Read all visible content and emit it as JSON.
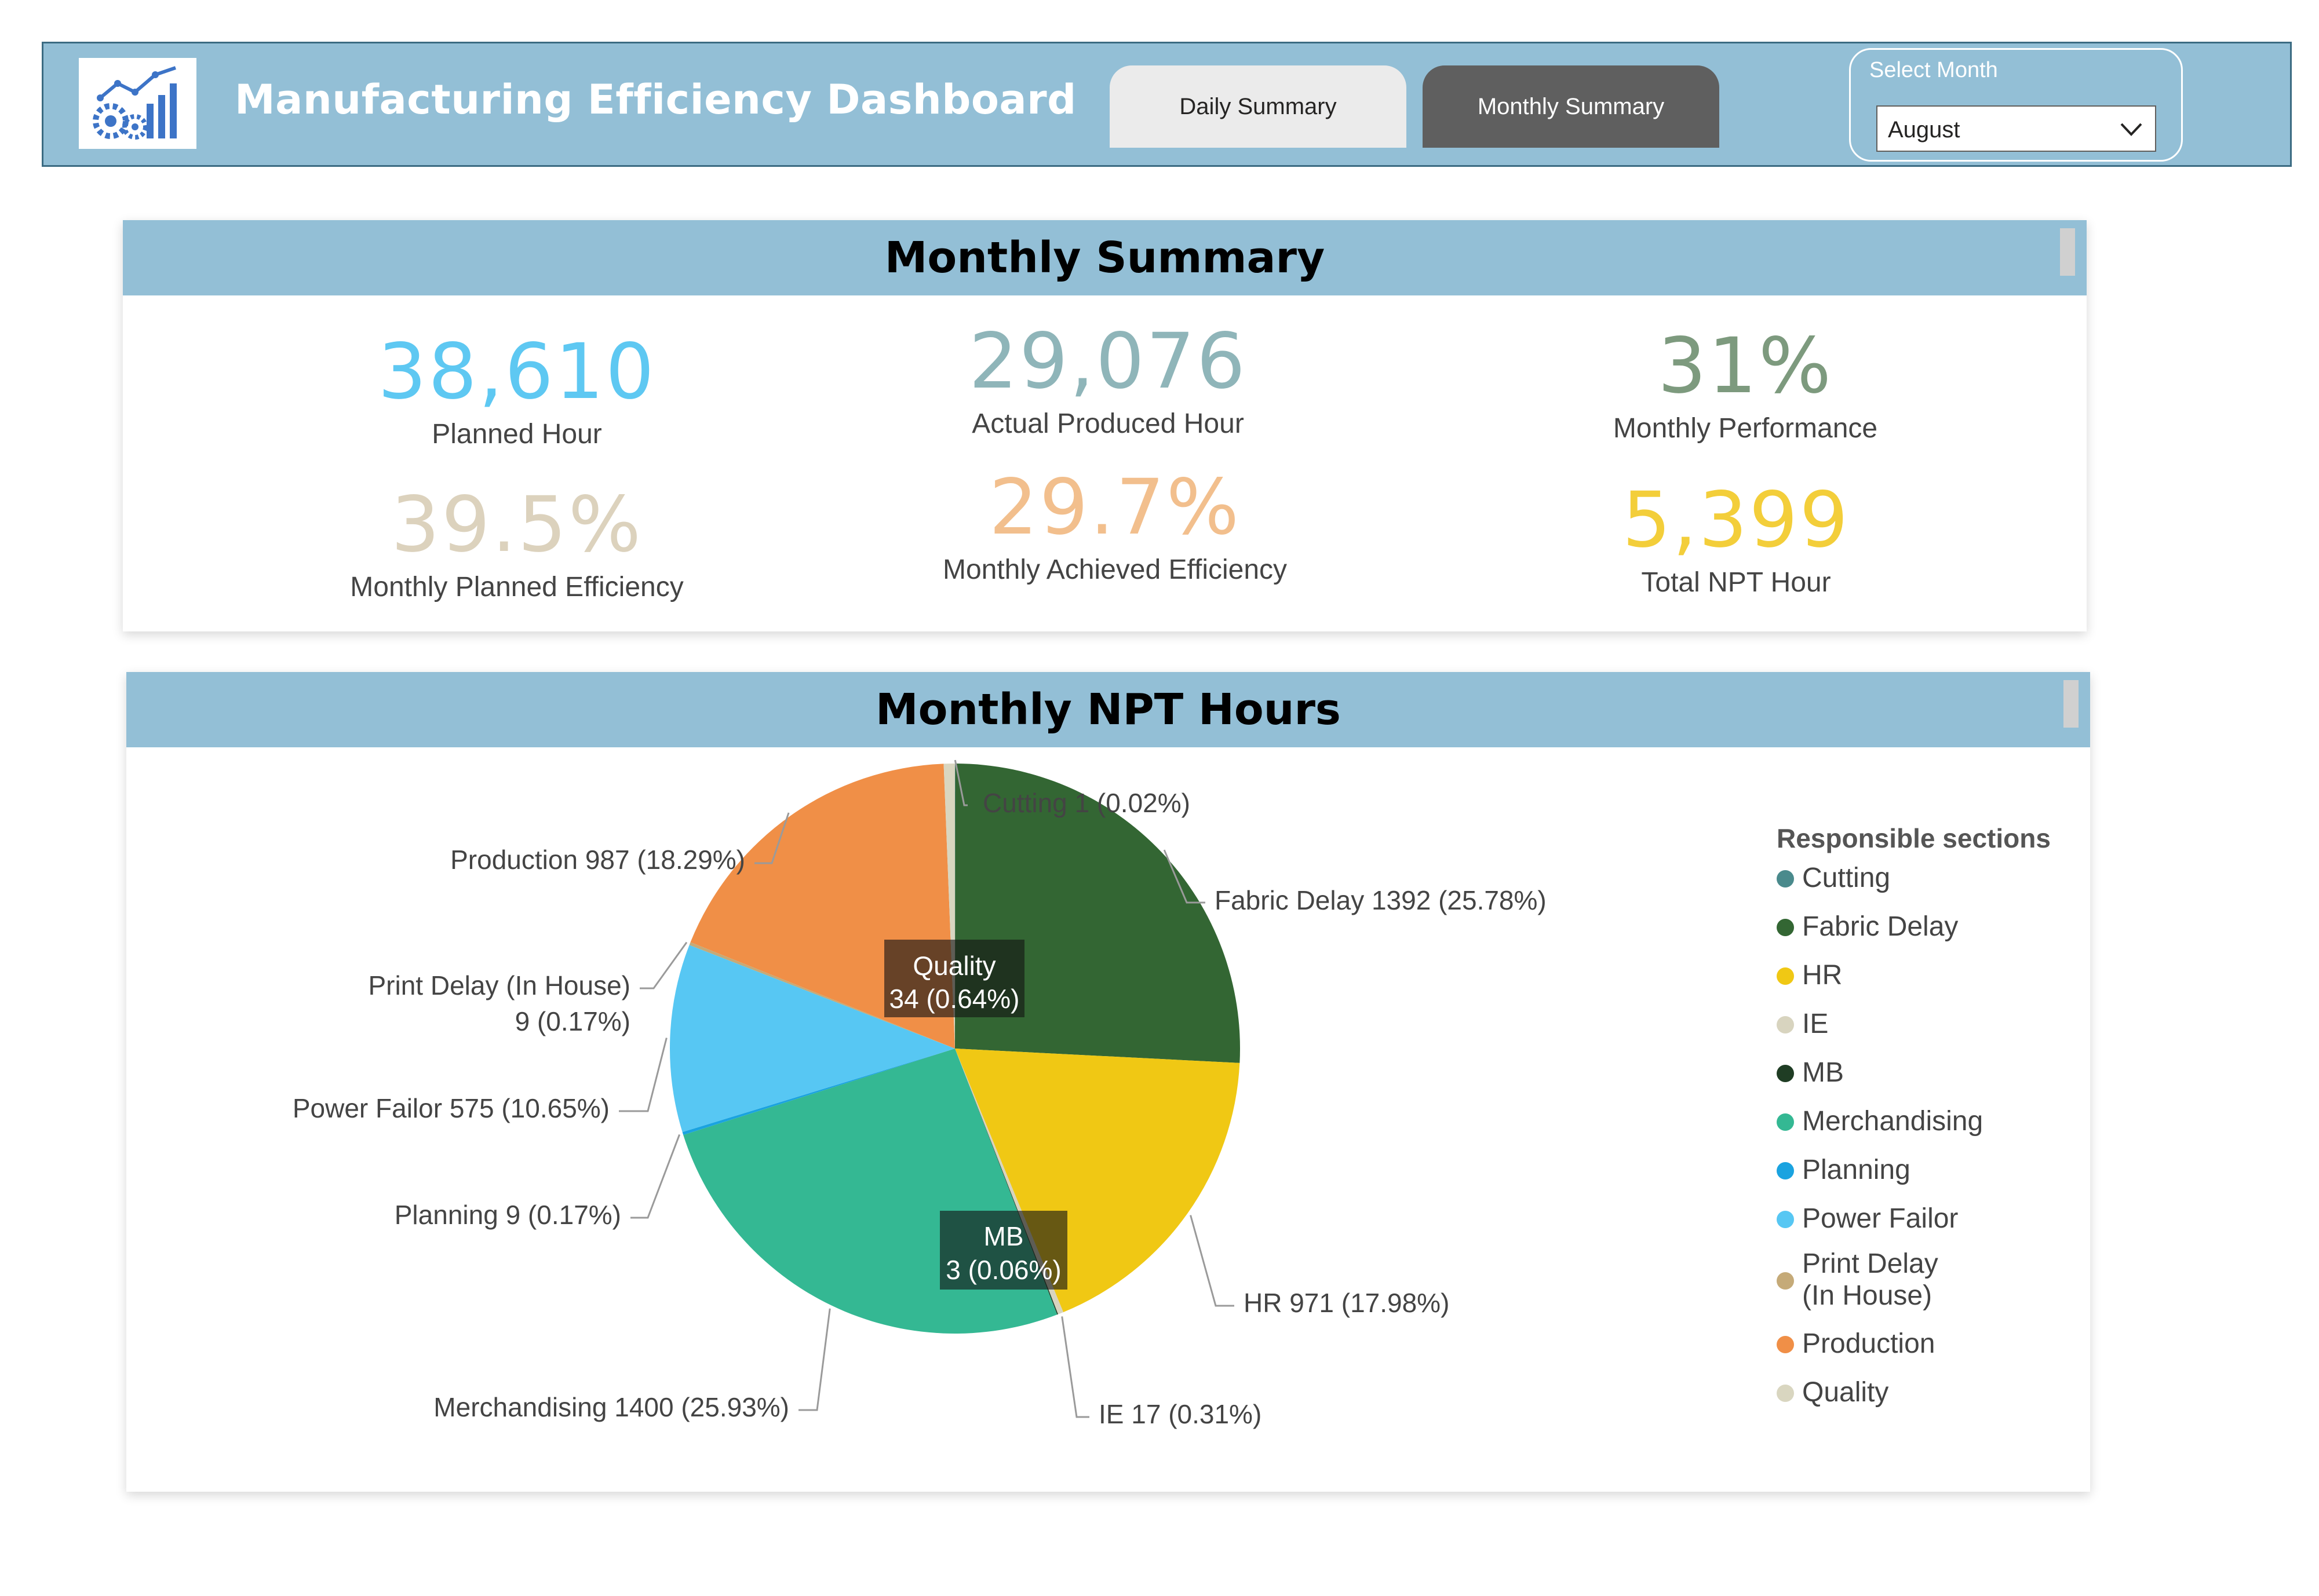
{
  "header": {
    "title": "Manufacturing Efficiency Dashboard",
    "logo_icon": "analytics-gears-icon",
    "tabs": [
      {
        "label": "Daily Summary",
        "active": false
      },
      {
        "label": "Monthly Summary",
        "active": true
      }
    ],
    "month_slicer": {
      "title": "Select Month",
      "selected": "August"
    }
  },
  "monthly_summary": {
    "title": "Monthly Summary",
    "kpis": [
      {
        "value": "38,610",
        "label": "Planned Hour",
        "color": "#5ec8f2"
      },
      {
        "value": "29,076",
        "label": "Actual Produced Hour",
        "color": "#8fb5b9"
      },
      {
        "value": "31%",
        "label": "Monthly Performance",
        "color": "#7d9a7e"
      },
      {
        "value": "39.5%",
        "label": "Monthly Planned Efficiency",
        "color": "#dcd2bd"
      },
      {
        "value": "29.7%",
        "label": "Monthly Achieved Efficiency",
        "color": "#f2bf8d"
      },
      {
        "value": "5,399",
        "label": "Total NPT Hour",
        "color": "#f3ce3a"
      }
    ]
  },
  "npt": {
    "title": "Monthly NPT Hours",
    "legend_title": "Responsible sections",
    "chart_data": {
      "type": "pie",
      "unit": "hours",
      "slices": [
        {
          "name": "Cutting",
          "legend": "Cutting",
          "value": 1,
          "percent": "0.02%",
          "label": "Cutting 1 (0.02%)",
          "color": "#4a8a8c"
        },
        {
          "name": "Fabric Delay",
          "legend": "Fabric Delay",
          "value": 1392,
          "percent": "25.78%",
          "label": "Fabric Delay 1392 (25.78%)",
          "color": "#336633"
        },
        {
          "name": "HR",
          "legend": "HR",
          "value": 971,
          "percent": "17.98%",
          "label": "HR 971 (17.98%)",
          "color": "#f0c814"
        },
        {
          "name": "IE",
          "legend": "IE",
          "value": 17,
          "percent": "0.31%",
          "label": "IE 17 (0.31%)",
          "color": "#d8d4bf"
        },
        {
          "name": "MB",
          "legend": "MB",
          "value": 3,
          "percent": "0.06%",
          "label_line1": "MB",
          "label_line2": "3 (0.06%)",
          "color": "#1f3d24"
        },
        {
          "name": "Merchandising",
          "legend": "Merchandising",
          "value": 1400,
          "percent": "25.93%",
          "label": "Merchandising 1400 (25.93%)",
          "color": "#34b893"
        },
        {
          "name": "Planning",
          "legend": "Planning",
          "value": 9,
          "percent": "0.17%",
          "label": "Planning 9 (0.17%)",
          "color": "#1aa3e0"
        },
        {
          "name": "Power Failor",
          "legend": "Power Failor",
          "value": 575,
          "percent": "10.65%",
          "label": "Power Failor 575 (10.65%)",
          "color": "#57c7f3"
        },
        {
          "name": "Print Delay (In House)",
          "legend_line1": "Print Delay",
          "legend_line2": "(In House)",
          "value": 9,
          "percent": "0.17%",
          "label_line1": "Print Delay (In House)",
          "label_line2": "9 (0.17%)",
          "color": "#c5aa78"
        },
        {
          "name": "Production",
          "legend": "Production",
          "value": 987,
          "percent": "18.29%",
          "label": "Production 987 (18.29%)",
          "color": "#f08f47"
        },
        {
          "name": "Quality",
          "legend": "Quality",
          "value": 34,
          "percent": "0.64%",
          "label_line1": "Quality",
          "label_line2": "34 (0.64%)",
          "color": "#d9d6c0"
        }
      ]
    }
  }
}
